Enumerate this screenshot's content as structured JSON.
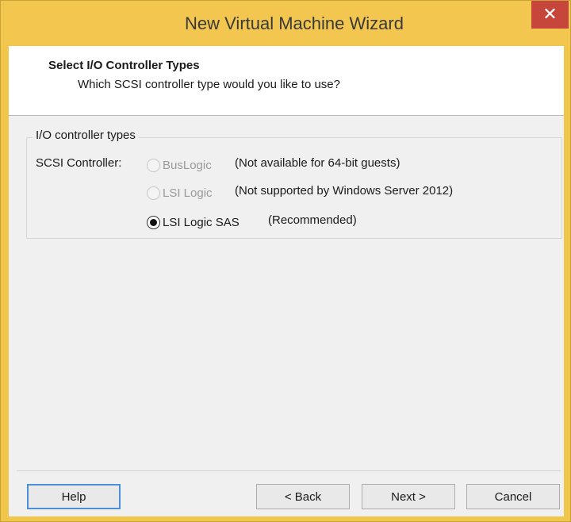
{
  "window": {
    "title": "New Virtual Machine Wizard",
    "close_glyph": "✕"
  },
  "header": {
    "title": "Select I/O Controller Types",
    "subtitle": "Which SCSI controller type would you like to use?"
  },
  "group": {
    "title": "I/O controller types",
    "scsi_label": "SCSI Controller:",
    "options": [
      {
        "label": "BusLogic",
        "note": "(Not available for 64-bit guests)",
        "selected": false,
        "enabled": false
      },
      {
        "label": "LSI Logic",
        "note": "(Not supported by Windows Server 2012)",
        "selected": false,
        "enabled": false
      },
      {
        "label": "LSI Logic SAS",
        "note": "(Recommended)",
        "selected": true,
        "enabled": true
      }
    ]
  },
  "buttons": {
    "help": "Help",
    "back": "< Back",
    "next": "Next >",
    "cancel": "Cancel"
  },
  "colors": {
    "titlebar": "#f2c64f",
    "close": "#c7463c",
    "focus_border": "#4a8fd8"
  }
}
